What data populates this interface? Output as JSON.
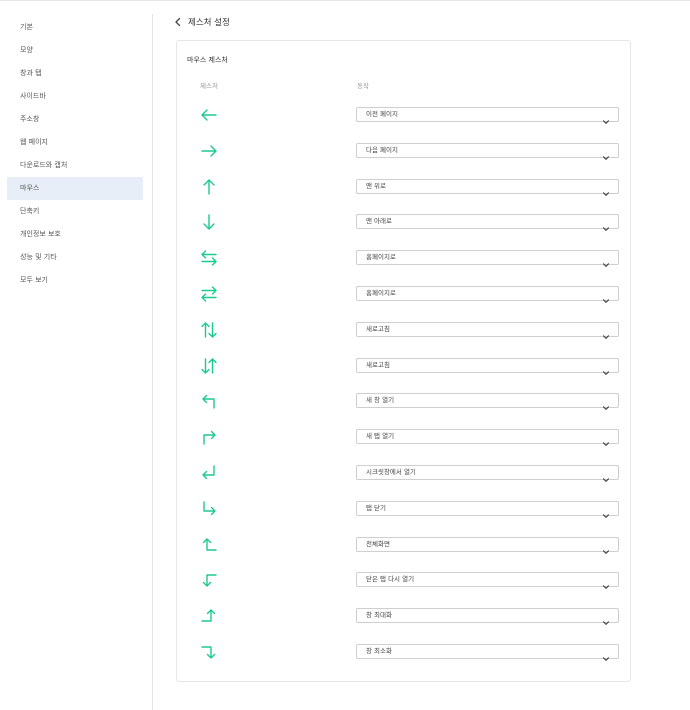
{
  "page": {
    "title": "제스처 설정"
  },
  "sidebar": {
    "items": [
      {
        "label": "기본"
      },
      {
        "label": "모양"
      },
      {
        "label": "창과 탭"
      },
      {
        "label": "사이드바"
      },
      {
        "label": "주소창"
      },
      {
        "label": "웹 페이지"
      },
      {
        "label": "다운로드와 캡처"
      },
      {
        "label": "마우스",
        "active": true
      },
      {
        "label": "단축키"
      },
      {
        "label": "개인정보 보호"
      },
      {
        "label": "성능 및 기타"
      },
      {
        "label": "모두 보기"
      }
    ]
  },
  "panel": {
    "title": "마우스 제스처",
    "col_gesture": "제스처",
    "col_action": "동작"
  },
  "accent_color": "#1ec98e",
  "gestures": [
    {
      "icon": "arrow-left-icon",
      "action": "이전 페이지"
    },
    {
      "icon": "arrow-right-icon",
      "action": "다음 페이지"
    },
    {
      "icon": "arrow-up-icon",
      "action": "맨 위로"
    },
    {
      "icon": "arrow-down-icon",
      "action": "맨 아래로"
    },
    {
      "icon": "arrow-left-right-icon",
      "action": "홈페이지로"
    },
    {
      "icon": "arrow-right-left-icon",
      "action": "홈페이지로"
    },
    {
      "icon": "arrow-up-down-icon",
      "action": "새로고침"
    },
    {
      "icon": "arrow-down-up-icon",
      "action": "새로고침"
    },
    {
      "icon": "arrow-up-left-icon",
      "action": "새 창 열기"
    },
    {
      "icon": "arrow-up-right-icon",
      "action": "새 탭 열기"
    },
    {
      "icon": "arrow-down-left-icon",
      "action": "시크릿창에서 열기"
    },
    {
      "icon": "arrow-down-right-icon",
      "action": "탭 닫기"
    },
    {
      "icon": "arrow-left-up-icon",
      "action": "전체화면"
    },
    {
      "icon": "arrow-left-down-icon",
      "action": "닫은 탭 다시 열기"
    },
    {
      "icon": "arrow-right-up-icon",
      "action": "창 최대화"
    },
    {
      "icon": "arrow-right-down-icon",
      "action": "창 최소화"
    }
  ]
}
